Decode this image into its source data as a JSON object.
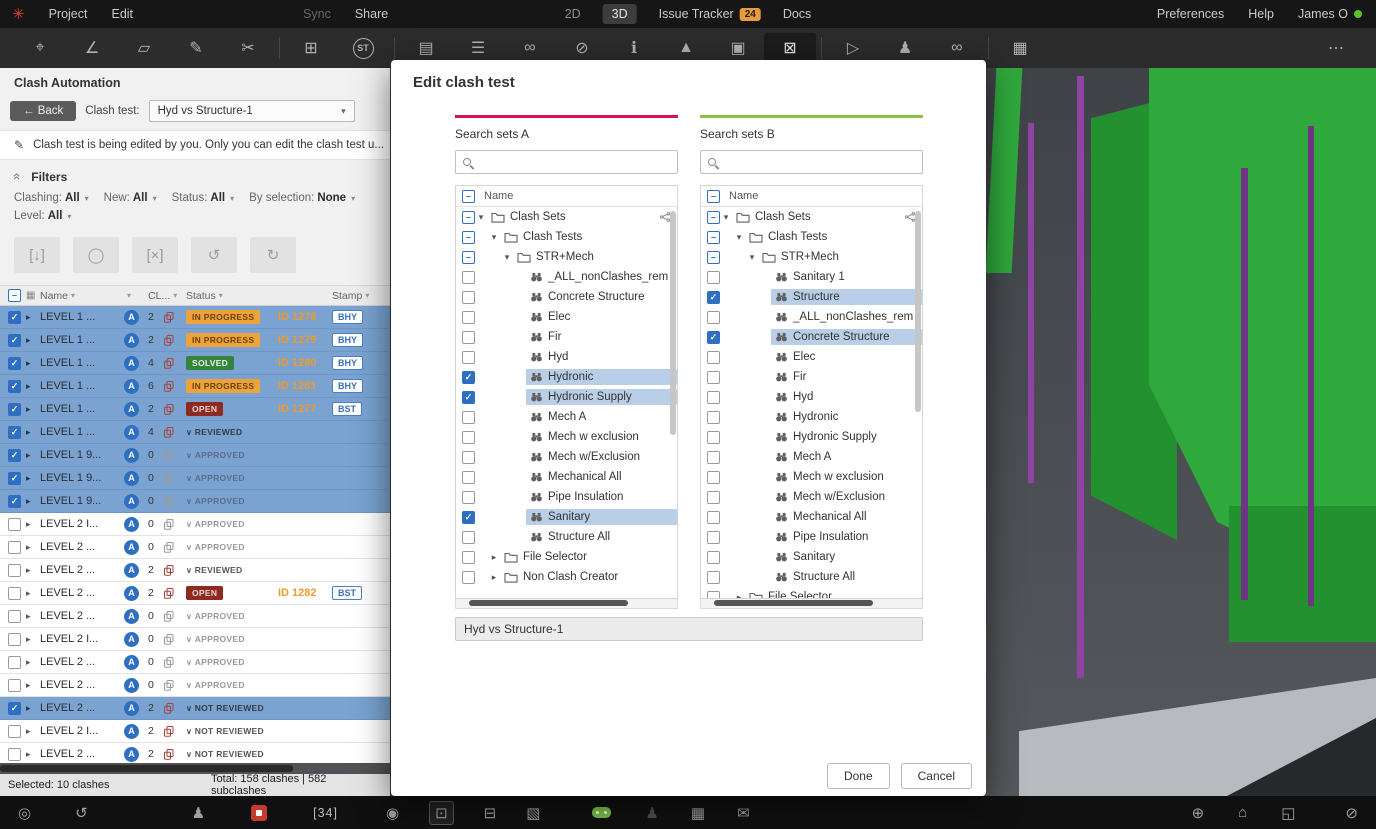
{
  "menubar": {
    "logo_glyph": "✳",
    "left": [
      {
        "label": "Project"
      },
      {
        "label": "Edit"
      }
    ],
    "mid": [
      {
        "label": "Sync",
        "disabled": true
      },
      {
        "label": "Share"
      }
    ],
    "center": [
      {
        "label": "2D",
        "dim": true
      },
      {
        "label": "3D",
        "active": true
      },
      {
        "label": "Issue Tracker",
        "badge": "24"
      },
      {
        "label": "Docs"
      }
    ],
    "right": [
      {
        "label": "Preferences"
      },
      {
        "label": "Help"
      },
      {
        "label": "James O",
        "online": true
      }
    ]
  },
  "toolbar": {
    "icons": [
      {
        "name": "waypoint-icon",
        "glyph": "⌖"
      },
      {
        "name": "measure-icon",
        "glyph": "∠"
      },
      {
        "name": "section-plane-icon",
        "glyph": "▱"
      },
      {
        "name": "markup-icon",
        "glyph": "✎"
      },
      {
        "name": "cut-icon",
        "glyph": "✂"
      },
      {
        "sep": true
      },
      {
        "name": "add-issue-icon",
        "glyph": "⊞"
      },
      {
        "name": "stamp-icon",
        "glyph": "ST",
        "circle": true
      },
      {
        "sep": true
      },
      {
        "name": "sheets-icon",
        "glyph": "▤"
      },
      {
        "name": "issue-list-icon",
        "glyph": "☰"
      },
      {
        "name": "search-sets-icon",
        "glyph": "∞"
      },
      {
        "name": "exclusion-icon",
        "glyph": "⊘"
      },
      {
        "name": "properties-icon",
        "glyph": "ℹ"
      },
      {
        "name": "viewpoint-icon",
        "glyph": "▲"
      },
      {
        "name": "report-icon",
        "glyph": "▣"
      },
      {
        "name": "clash-automation-icon",
        "glyph": "⊠",
        "active": true
      },
      {
        "sep": true
      },
      {
        "name": "video-icon",
        "glyph": "▷"
      },
      {
        "name": "collaborators-icon",
        "glyph": "♟"
      },
      {
        "name": "link-icon",
        "glyph": "∞"
      },
      {
        "sep": true
      },
      {
        "name": "windows-icon",
        "glyph": "▦"
      },
      {
        "name": "more-icon",
        "glyph": "⋯",
        "push": true
      }
    ]
  },
  "panel": {
    "title": "Clash Automation",
    "back_label": "← Back",
    "clash_test_label": "Clash test:",
    "clash_test_value": "Hyd vs Structure-1",
    "edit_notice": "Clash test is being edited by you. Only you can edit the clash test u...",
    "filters": {
      "title": "Filters",
      "items": [
        {
          "label": "Clashing:",
          "value": "All"
        },
        {
          "label": "New:",
          "value": "All"
        },
        {
          "label": "Status:",
          "value": "All"
        },
        {
          "label": "By selection:",
          "value": "None"
        }
      ],
      "level": {
        "label": "Level:",
        "value": "All"
      }
    },
    "tools": [
      {
        "name": "box-select-icon",
        "glyph": "[↓]"
      },
      {
        "name": "circle-select-icon",
        "glyph": "◯"
      },
      {
        "name": "box-deselect-icon",
        "glyph": "[×]"
      },
      {
        "name": "refresh-ccw-icon",
        "glyph": "↺"
      },
      {
        "name": "refresh-cw-icon",
        "glyph": "↻"
      }
    ],
    "table": {
      "avatar": "A",
      "headers": [
        {
          "label": "Name"
        },
        {
          "label": ""
        },
        {
          "label": "CL..."
        },
        {
          "label": "Status"
        },
        {
          "label": "Stamp"
        }
      ],
      "rows": [
        {
          "name": "LEVEL 1 ...",
          "count": "2",
          "status": "IN PROGRESS",
          "status_type": "in-progress",
          "id": "ID 1278",
          "stamp": "BHY",
          "selected": true
        },
        {
          "name": "LEVEL 1 ...",
          "count": "2",
          "status": "IN PROGRESS",
          "status_type": "in-progress",
          "id": "ID 1279",
          "stamp": "BHY",
          "selected": true
        },
        {
          "name": "LEVEL 1 ...",
          "count": "4",
          "status": "SOLVED",
          "status_type": "solved",
          "id": "ID 1280",
          "stamp": "BHY",
          "selected": true
        },
        {
          "name": "LEVEL 1 ...",
          "count": "6",
          "status": "IN PROGRESS",
          "status_type": "in-progress",
          "id": "ID 1281",
          "stamp": "BHY",
          "selected": true
        },
        {
          "name": "LEVEL 1 ...",
          "count": "2",
          "status": "OPEN",
          "status_type": "open",
          "id": "ID 1277",
          "stamp": "BST",
          "selected": true
        },
        {
          "name": "LEVEL 1 ...",
          "count": "4",
          "status": "REVIEWED",
          "status_type": "plain",
          "selected": true
        },
        {
          "name": "LEVEL 1 9...",
          "count": "0",
          "status": "APPROVED",
          "status_type": "plain",
          "selected": true,
          "muted": true
        },
        {
          "name": "LEVEL 1 9...",
          "count": "0",
          "status": "APPROVED",
          "status_type": "plain",
          "selected": true,
          "muted": true
        },
        {
          "name": "LEVEL 1 9...",
          "count": "0",
          "status": "APPROVED",
          "status_type": "plain",
          "selected": true,
          "muted": true
        },
        {
          "name": "LEVEL 2 I...",
          "count": "0",
          "status": "APPROVED",
          "status_type": "plain",
          "muted": true
        },
        {
          "name": "LEVEL 2 ...",
          "count": "0",
          "status": "APPROVED",
          "status_type": "plain",
          "muted": true
        },
        {
          "name": "LEVEL 2 ...",
          "count": "2",
          "status": "REVIEWED",
          "status_type": "plain"
        },
        {
          "name": "LEVEL 2 ...",
          "count": "2",
          "status": "OPEN",
          "status_type": "open",
          "id": "ID 1282",
          "stamp": "BST"
        },
        {
          "name": "LEVEL 2 ...",
          "count": "0",
          "status": "APPROVED",
          "status_type": "plain",
          "muted": true
        },
        {
          "name": "LEVEL 2 I...",
          "count": "0",
          "status": "APPROVED",
          "status_type": "plain",
          "muted": true
        },
        {
          "name": "LEVEL 2 ...",
          "count": "0",
          "status": "APPROVED",
          "status_type": "plain",
          "muted": true
        },
        {
          "name": "LEVEL 2 ...",
          "count": "0",
          "status": "APPROVED",
          "status_type": "plain",
          "muted": true
        },
        {
          "name": "LEVEL 2 ...",
          "count": "2",
          "status": "NOT REVIEWED",
          "status_type": "plain",
          "selected": true
        },
        {
          "name": "LEVEL 2 I...",
          "count": "2",
          "status": "NOT REVIEWED",
          "status_type": "plain"
        },
        {
          "name": "LEVEL 2 ...",
          "count": "2",
          "status": "NOT REVIEWED",
          "status_type": "plain"
        }
      ]
    },
    "footer": {
      "selected": "Selected: 10 clashes",
      "total": "Total: 158 clashes | 582 subclashes"
    }
  },
  "modal": {
    "title": "Edit clash test",
    "tree_header": "Name",
    "name_value": "Hyd vs Structure-1",
    "done_label": "Done",
    "cancel_label": "Cancel",
    "panels": [
      {
        "title": "Search sets A",
        "accent": "#d4145a",
        "tree": [
          {
            "indent": 0,
            "type": "folder",
            "label": "Clash Sets",
            "check": "indeterminate",
            "expanded": true,
            "share": true
          },
          {
            "indent": 1,
            "type": "folder",
            "label": "Clash Tests",
            "check": "indeterminate",
            "expanded": true
          },
          {
            "indent": 2,
            "type": "folder",
            "label": "STR+Mech",
            "check": "indeterminate",
            "expanded": true
          },
          {
            "indent": 3,
            "type": "item",
            "label": "_ALL_nonClashes_rem",
            "check": "unchecked"
          },
          {
            "indent": 3,
            "type": "item",
            "label": "Concrete Structure",
            "check": "unchecked"
          },
          {
            "indent": 3,
            "type": "item",
            "label": "Elec",
            "check": "unchecked"
          },
          {
            "indent": 3,
            "type": "item",
            "label": "Fir",
            "check": "unchecked"
          },
          {
            "indent": 3,
            "type": "item",
            "label": "Hyd",
            "check": "unchecked"
          },
          {
            "indent": 3,
            "type": "item",
            "label": "Hydronic",
            "check": "checked",
            "highlighted": true
          },
          {
            "indent": 3,
            "type": "item",
            "label": "Hydronic Supply",
            "check": "checked",
            "highlighted": true
          },
          {
            "indent": 3,
            "type": "item",
            "label": "Mech A",
            "check": "unchecked"
          },
          {
            "indent": 3,
            "type": "item",
            "label": "Mech w exclusion",
            "check": "unchecked"
          },
          {
            "indent": 3,
            "type": "item",
            "label": "Mech w/Exclusion",
            "check": "unchecked"
          },
          {
            "indent": 3,
            "type": "item",
            "label": "Mechanical All",
            "check": "unchecked"
          },
          {
            "indent": 3,
            "type": "item",
            "label": "Pipe Insulation",
            "check": "unchecked"
          },
          {
            "indent": 3,
            "type": "item",
            "label": "Sanitary",
            "check": "checked",
            "highlighted": true
          },
          {
            "indent": 3,
            "type": "item",
            "label": "Structure All",
            "check": "unchecked"
          },
          {
            "indent": 1,
            "type": "folder",
            "label": "File Selector",
            "check": "unchecked",
            "expanded": false
          },
          {
            "indent": 1,
            "type": "folder",
            "label": "Non Clash Creator",
            "check": "unchecked",
            "expanded": false
          }
        ]
      },
      {
        "title": "Search sets B",
        "accent": "#8bc34a",
        "tree": [
          {
            "indent": 0,
            "type": "folder",
            "label": "Clash Sets",
            "check": "indeterminate",
            "expanded": true,
            "share": true
          },
          {
            "indent": 1,
            "type": "folder",
            "label": "Clash Tests",
            "check": "indeterminate",
            "expanded": true
          },
          {
            "indent": 2,
            "type": "folder",
            "label": "STR+Mech",
            "check": "indeterminate",
            "expanded": true
          },
          {
            "indent": 3,
            "type": "item",
            "label": "Sanitary 1",
            "check": "unchecked"
          },
          {
            "indent": 3,
            "type": "item",
            "label": "Structure",
            "check": "checked",
            "highlighted": true
          },
          {
            "indent": 3,
            "type": "item",
            "label": "_ALL_nonClashes_rem",
            "check": "unchecked"
          },
          {
            "indent": 3,
            "type": "item",
            "label": "Concrete Structure",
            "check": "checked",
            "highlighted": true
          },
          {
            "indent": 3,
            "type": "item",
            "label": "Elec",
            "check": "unchecked"
          },
          {
            "indent": 3,
            "type": "item",
            "label": "Fir",
            "check": "unchecked"
          },
          {
            "indent": 3,
            "type": "item",
            "label": "Hyd",
            "check": "unchecked"
          },
          {
            "indent": 3,
            "type": "item",
            "label": "Hydronic",
            "check": "unchecked"
          },
          {
            "indent": 3,
            "type": "item",
            "label": "Hydronic Supply",
            "check": "unchecked"
          },
          {
            "indent": 3,
            "type": "item",
            "label": "Mech A",
            "check": "unchecked"
          },
          {
            "indent": 3,
            "type": "item",
            "label": "Mech w exclusion",
            "check": "unchecked"
          },
          {
            "indent": 3,
            "type": "item",
            "label": "Mech w/Exclusion",
            "check": "unchecked"
          },
          {
            "indent": 3,
            "type": "item",
            "label": "Mechanical All",
            "check": "unchecked"
          },
          {
            "indent": 3,
            "type": "item",
            "label": "Pipe Insulation",
            "check": "unchecked"
          },
          {
            "indent": 3,
            "type": "item",
            "label": "Sanitary",
            "check": "unchecked"
          },
          {
            "indent": 3,
            "type": "item",
            "label": "Structure All",
            "check": "unchecked"
          },
          {
            "indent": 1,
            "type": "folder",
            "label": "File Selector",
            "check": "unchecked",
            "expanded": false
          }
        ]
      }
    ]
  },
  "bottombar": {
    "frame_counter": "[34]",
    "icons": [
      {
        "name": "locate-icon",
        "glyph": "◎"
      },
      {
        "name": "undo-icon",
        "glyph": "↺",
        "gap": 44
      },
      {
        "name": "avatar-walk-icon",
        "glyph": "♟",
        "gap": 104
      },
      {
        "name": "app-logo-icon",
        "type": "applogo",
        "gap": 46
      },
      {
        "name": "frame-counter",
        "type": "text",
        "label": "[34]",
        "gap": 46
      },
      {
        "name": "visibility-icon",
        "glyph": "◉",
        "gap": 48
      },
      {
        "name": "section-box-icon",
        "glyph": "⊡",
        "gap": 30,
        "active": true
      },
      {
        "name": "clip-icon",
        "glyph": "⊟",
        "gap": 30
      },
      {
        "name": "layers-icon",
        "glyph": "▧",
        "gap": 30
      },
      {
        "name": "gamepad-icon",
        "type": "gamepad",
        "gap": 52
      },
      {
        "name": "walk-icon",
        "glyph": "♟",
        "dim": true,
        "gap": 34
      },
      {
        "name": "apps-icon",
        "glyph": "▦",
        "gap": 32
      },
      {
        "name": "chat-icon",
        "glyph": "✉",
        "gap": 32
      },
      {
        "name": "world-icon",
        "glyph": "⊕",
        "push": true
      },
      {
        "name": "home-icon",
        "glyph": "⌂",
        "gap": 34
      },
      {
        "name": "fullscreen-icon",
        "glyph": "◱",
        "gap": 34
      },
      {
        "name": "record-icon",
        "glyph": "⊘",
        "gap": 50
      }
    ]
  },
  "viewport": {
    "colors": {
      "bg1": "#3f4247",
      "bg2": "#55585c",
      "green": "#2fa83c",
      "green_dark": "#239130",
      "purple": "#8e44a0",
      "purple_dark": "#6f3585",
      "floor": "#b7bbbf",
      "corner": "#26282c"
    }
  }
}
